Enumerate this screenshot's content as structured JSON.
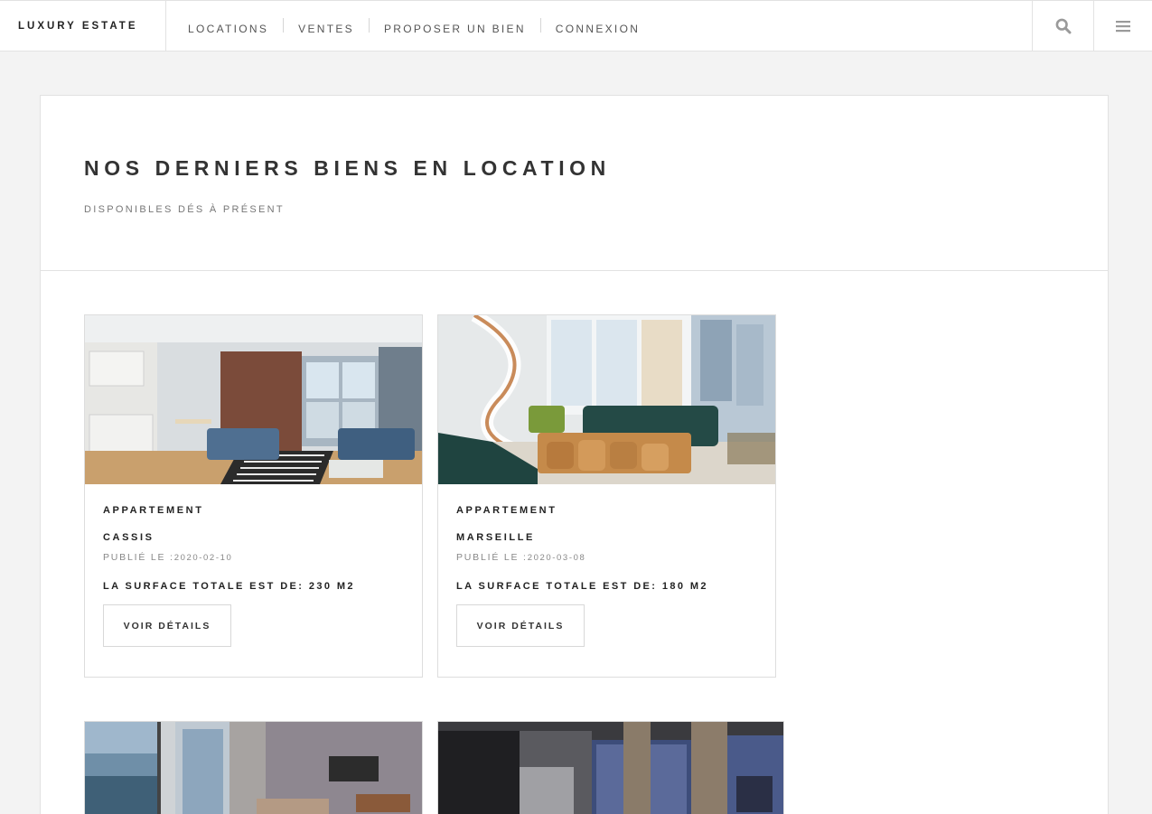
{
  "header": {
    "brand": "LUXURY ESTATE",
    "nav": [
      {
        "label": "LOCATIONS"
      },
      {
        "label": "VENTES"
      },
      {
        "label": "PROPOSER UN BIEN"
      },
      {
        "label": "CONNEXION"
      }
    ],
    "search_icon": "search-icon",
    "menu_icon": "hamburger-menu-icon"
  },
  "section": {
    "title": "NOS DERNIERS BIENS EN LOCATION",
    "subtitle": "DISPONIBLES DÉS À PRÉSENT"
  },
  "listings": [
    {
      "type": "APPARTEMENT",
      "city": "CASSIS",
      "published_label": "PUBLIÉ LE :",
      "date": "2020-02-10",
      "surface": "LA SURFACE TOTALE EST DE: 230 M2",
      "button": "VOIR DÉTAILS"
    },
    {
      "type": "APPARTEMENT",
      "city": "MARSEILLE",
      "published_label": "PUBLIÉ LE :",
      "date": "2020-03-08",
      "surface": "LA SURFACE TOTALE EST DE: 180 M2",
      "button": "VOIR DÉTAILS"
    }
  ],
  "colors": {
    "background": "#f3f3f3",
    "panel": "#ffffff",
    "text": "#333333",
    "muted": "#888888",
    "border": "#e2e2e2"
  }
}
